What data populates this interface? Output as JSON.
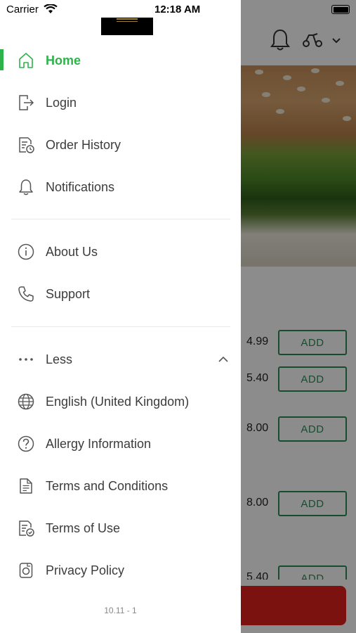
{
  "status_bar": {
    "carrier": "Carrier",
    "time": "12:18 AM",
    "wifi_icon": "wifi-icon",
    "battery_icon": "battery-icon"
  },
  "drawer": {
    "logo": "brand-logo",
    "accent_color": "#2db34a",
    "menu_primary": [
      {
        "label": "Home",
        "icon": "home-icon",
        "active": true
      },
      {
        "label": "Login",
        "icon": "login-icon"
      },
      {
        "label": "Order History",
        "icon": "order-history-icon"
      },
      {
        "label": "Notifications",
        "icon": "bell-icon"
      }
    ],
    "menu_secondary": [
      {
        "label": "About Us",
        "icon": "info-icon"
      },
      {
        "label": "Support",
        "icon": "phone-icon"
      }
    ],
    "menu_more": {
      "toggle_label": "Less",
      "items": [
        {
          "label": "English (United Kingdom)",
          "icon": "globe-icon"
        },
        {
          "label": "Allergy Information",
          "icon": "question-icon"
        },
        {
          "label": "Terms and Conditions",
          "icon": "document-icon"
        },
        {
          "label": "Terms of Use",
          "icon": "document-check-icon"
        },
        {
          "label": "Privacy Policy",
          "icon": "privacy-icon"
        }
      ]
    },
    "version": "10.11 - 1"
  },
  "background": {
    "items": [
      {
        "price": "4.99",
        "add_label": "ADD"
      },
      {
        "price": "5.40",
        "add_label": "ADD"
      },
      {
        "price": "8.00",
        "add_label": "ADD"
      },
      {
        "price": "8.00",
        "add_label": "ADD"
      },
      {
        "price": "5.40",
        "add_label": "ADD"
      }
    ],
    "add_color": "#2e8b57",
    "cart_color": "#e0221c"
  }
}
